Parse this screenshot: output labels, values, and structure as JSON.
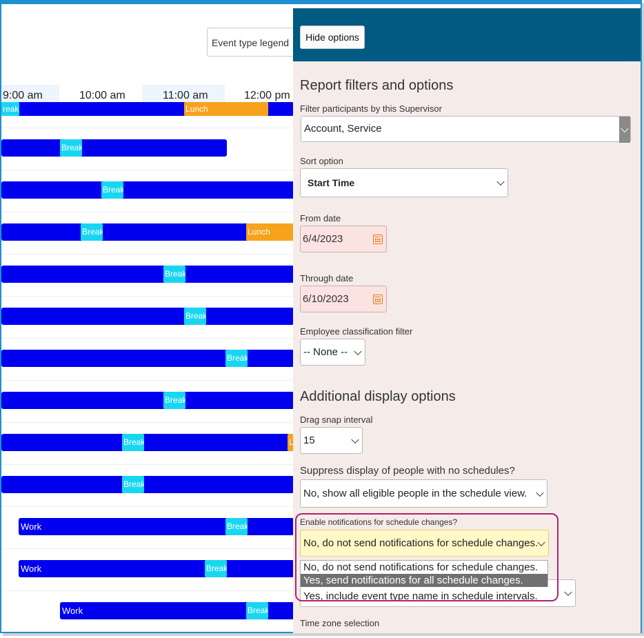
{
  "legend_button": "Event type legend",
  "times": [
    "9:00 am",
    "10:00 am",
    "11:00 am",
    "12:00 pm"
  ],
  "events": {
    "break": "Break",
    "lunch": "Lunch",
    "lunch_partial": "Lu",
    "break_partial": "reak",
    "work": "Work"
  },
  "panel": {
    "hide_button": "Hide options",
    "section1_title": "Report filters and options",
    "supervisor_label": "Filter participants by this Supervisor",
    "supervisor_value": "Account, Service",
    "sort_label": "Sort option",
    "sort_value": "Start Time",
    "from_label": "From date",
    "from_value": "6/4/2023",
    "through_label": "Through date",
    "through_value": "6/10/2023",
    "classification_label": "Employee classification filter",
    "classification_value": "-- None --",
    "section2_title": "Additional display options",
    "snap_label": "Drag snap interval",
    "snap_value": "15",
    "suppress_label": "Suppress display of people with no schedules?",
    "suppress_value": "No, show all eligible people in the schedule view.",
    "notify_label": "Enable notifications for schedule changes?",
    "notify_value": "No, do not send notifications for schedule changes.",
    "notify_options": [
      "No, do not send notifications for schedule changes.",
      "Yes, send notifications for all schedule changes."
    ],
    "next_select_value": "Yes, include event type name in schedule intervals.",
    "timezone_label": "Time zone selection"
  },
  "colors": {
    "header": "#005a82",
    "work": "#0000ee",
    "break": "#19d6f0",
    "lunch": "#f7a21b",
    "highlight": "#b3216b"
  }
}
